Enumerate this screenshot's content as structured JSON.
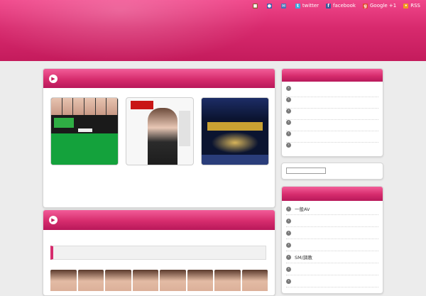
{
  "header": {
    "title": "",
    "description": "",
    "nav": [
      {
        "label": "",
        "icon": "document-icon",
        "color": "#8a5a2b"
      },
      {
        "label": "",
        "icon": "user-icon",
        "color": "#3b5fa8"
      },
      {
        "label": "",
        "icon": "mail-icon",
        "color": "#4a6fb5"
      },
      {
        "label": "twitter",
        "icon": "twitter-icon",
        "color": "#3aaae1"
      },
      {
        "label": "facebook",
        "icon": "facebook-icon",
        "color": "#3b5998"
      },
      {
        "label": "Google +1",
        "icon": "google-plus-icon",
        "color": "#e04a2d"
      },
      {
        "label": "RSS",
        "icon": "rss-icon",
        "color": "#f19a1f"
      }
    ]
  },
  "main": {
    "featured": {
      "heading": "",
      "cards": [
        {
          "title": "",
          "description": ""
        },
        {
          "title": "",
          "description": ""
        },
        {
          "title": "",
          "description": ""
        }
      ]
    },
    "article": {
      "heading": "",
      "subheading": ""
    }
  },
  "sidebar": {
    "links": {
      "heading": "",
      "items": [
        "",
        "",
        "",
        "",
        "",
        ""
      ]
    },
    "search": {
      "placeholder": ""
    },
    "categories": {
      "heading": "",
      "items": [
        "一般AV",
        "",
        "",
        "",
        "SM/調教",
        "",
        ""
      ]
    }
  },
  "colors": {
    "accent": "#d62c6d",
    "link": "#1a5bb5"
  }
}
